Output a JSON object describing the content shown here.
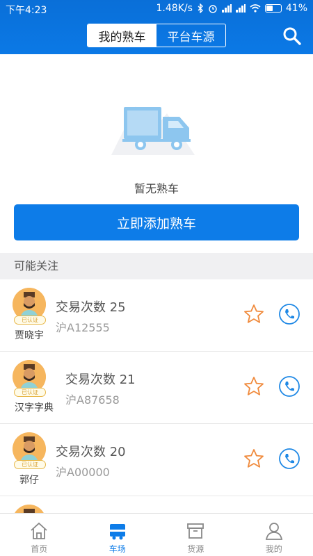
{
  "status_bar": {
    "time": "下午4:23",
    "speed": "1.48K/s",
    "battery": "41%"
  },
  "header": {
    "tabs": [
      {
        "label": "我的熟车",
        "active": true
      },
      {
        "label": "平台车源",
        "active": false
      }
    ],
    "search_icon": "search-icon"
  },
  "empty_state": {
    "icon": "truck-icon",
    "text": "暂无熟车",
    "button": "立即添加熟车"
  },
  "section_title": "可能关注",
  "list": [
    {
      "name": "贾晓宇",
      "badge": "已认证",
      "count": "交易次数 25",
      "plate": "沪A12555"
    },
    {
      "name": "汉字字典",
      "badge": "已认证",
      "count": "交易次数 21",
      "plate": "沪A87658"
    },
    {
      "name": "郭仔",
      "badge": "已认证",
      "count": "交易次数 20",
      "plate": "沪A00000"
    }
  ],
  "tabbar": [
    {
      "label": "首页",
      "icon": "home-icon",
      "active": false
    },
    {
      "label": "车场",
      "icon": "truck-yard-icon",
      "active": true
    },
    {
      "label": "货源",
      "icon": "box-icon",
      "active": false
    },
    {
      "label": "我的",
      "icon": "person-icon",
      "active": false
    }
  ],
  "colors": {
    "primary": "#0d7ce8",
    "star": "#f08a3c",
    "badge": "#e8b84a"
  }
}
